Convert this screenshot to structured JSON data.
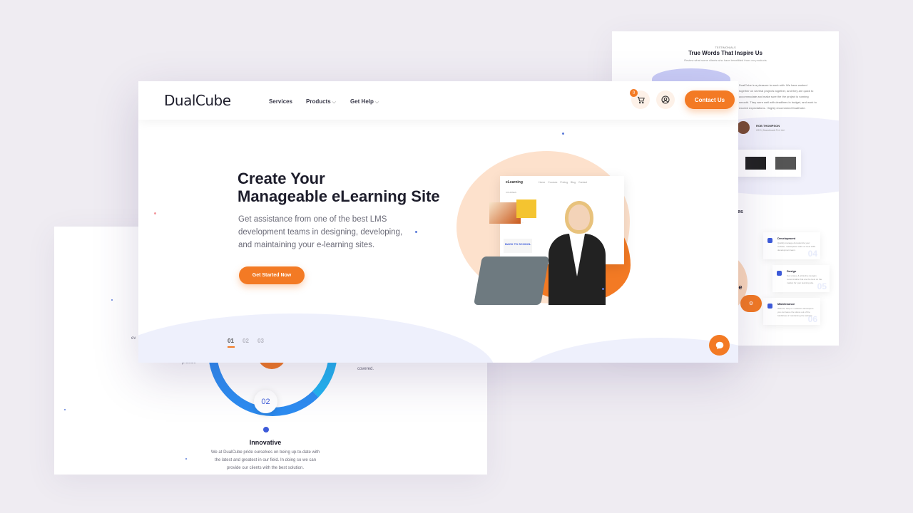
{
  "header": {
    "brand": "DualCube",
    "nav": [
      {
        "label": "Services",
        "has_dropdown": false
      },
      {
        "label": "Products",
        "has_dropdown": true
      },
      {
        "label": "Get Help",
        "has_dropdown": true
      }
    ],
    "cart_count": "0",
    "contact_label": "Contact Us"
  },
  "hero": {
    "title_line1": "Create Your",
    "title_line2": "Manageable eLearning Site",
    "description": "Get assistance from one of the best LMS development teams in designing, developing, and maintaining your e-learning sites.",
    "cta_label": "Get Started Now",
    "slides": [
      "01",
      "02",
      "03"
    ],
    "active_slide": 0
  },
  "mockup": {
    "logo": "eLearning",
    "nav": "Home Courses Pricing Blog Contact",
    "subtitle": "COURSES",
    "school_label": "BACK TO SCHOOL"
  },
  "left_card": {
    "step": "02",
    "title": "Innovative",
    "text": "We at DualCube pride ourselves on being up-to-date with the latest and greatest in our field. In doing so we can provide our clients with the best solution.",
    "covered": "covered.",
    "fragment_a": "provide",
    "fragment_b": "ev"
  },
  "right_card": {
    "eyebrow": "TESTIMONIALS",
    "title": "True Words That Inspire Us",
    "subtitle": "Review what some clients who have benefitted from our products",
    "quote": "DualCube is a pleasure to work with. We have worked together on several projects together, and they are quick to accommodate and make sure the the project is running smooth. They were well with deadlines in budget, and work to exceed expectations. I highly recommend DualCube.",
    "author": "ROB THOMPSON",
    "role": "CEO, Brandmark Pvt. Ltd.",
    "services_heading": "es",
    "services_partial": "be",
    "services": [
      {
        "name": "Development",
        "desc": "Quickly manage & customize your website, marketplace with our best LMS development team.",
        "num": "04"
      },
      {
        "name": "Design",
        "desc": "Get unique & attractive designs customizable that are the best on the market for your learning site.",
        "num": "05"
      },
      {
        "name": "Maintenance",
        "desc": "With the help of ‘s efficient developers you can leave the stress out of the hardships of maintaining the website.",
        "num": "06"
      }
    ]
  },
  "colors": {
    "accent": "#f37a24",
    "blue": "#3d5bd9",
    "background": "#efecf2"
  }
}
